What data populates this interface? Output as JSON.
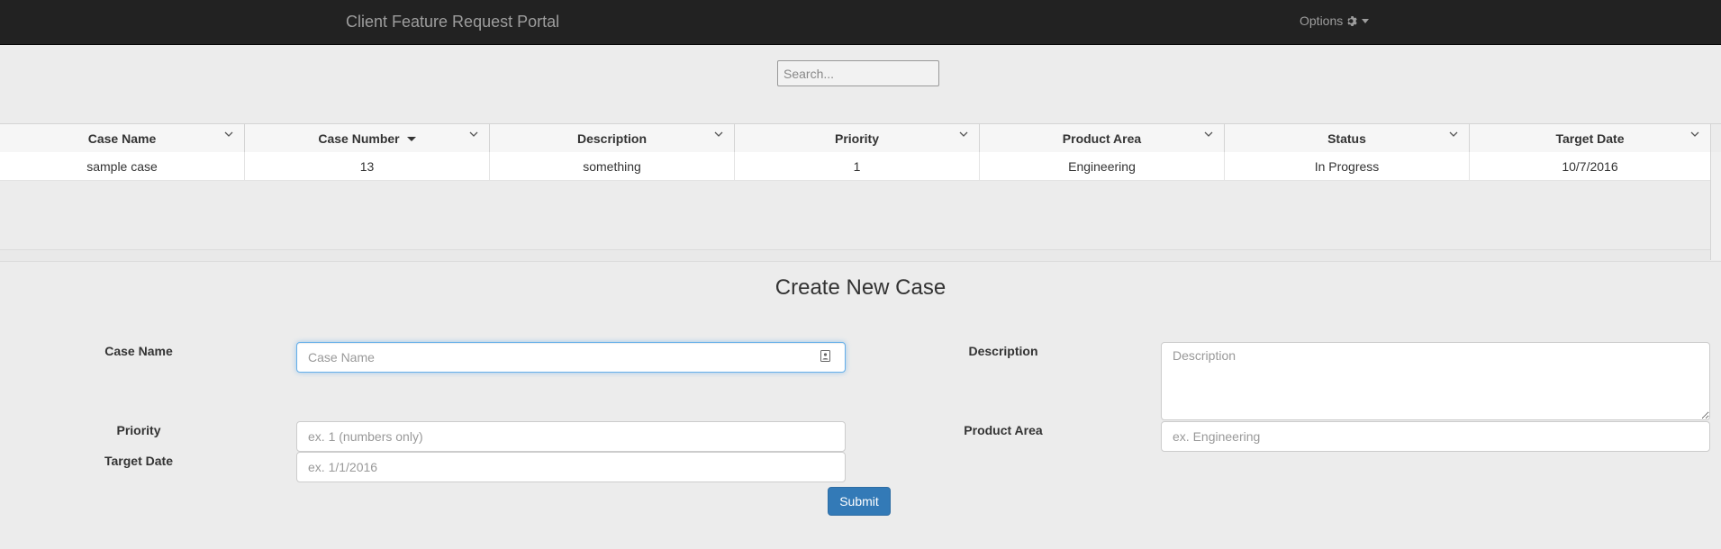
{
  "navbar": {
    "brand": "Client Feature Request Portal",
    "options_label": "Options"
  },
  "search": {
    "placeholder": "Search..."
  },
  "grid": {
    "columns": [
      "Case Name",
      "Case Number",
      "Description",
      "Priority",
      "Product Area",
      "Status",
      "Target Date"
    ],
    "sorted_column": "Case Number",
    "rows": [
      [
        "sample case",
        "13",
        "something",
        "1",
        "Engineering",
        "In Progress",
        "10/7/2016"
      ]
    ]
  },
  "form": {
    "title": "Create New Case",
    "case_name_label": "Case Name",
    "case_name_placeholder": "Case Name",
    "description_label": "Description",
    "description_placeholder": "Description",
    "priority_label": "Priority",
    "priority_placeholder": "ex. 1 (numbers only)",
    "product_area_label": "Product Area",
    "product_area_placeholder": "ex. Engineering",
    "target_date_label": "Target Date",
    "target_date_placeholder": "ex. 1/1/2016",
    "submit_label": "Submit"
  },
  "colors": {
    "navbar_bg": "#222222",
    "accent": "#337ab7",
    "focus": "#66afe9"
  },
  "icons": {
    "options": "gear-icon",
    "options_caret": "caret-down-icon",
    "column_menu": "chevron-down-icon",
    "sort": "sort-descending-icon",
    "autofill": "contact-card-icon"
  }
}
